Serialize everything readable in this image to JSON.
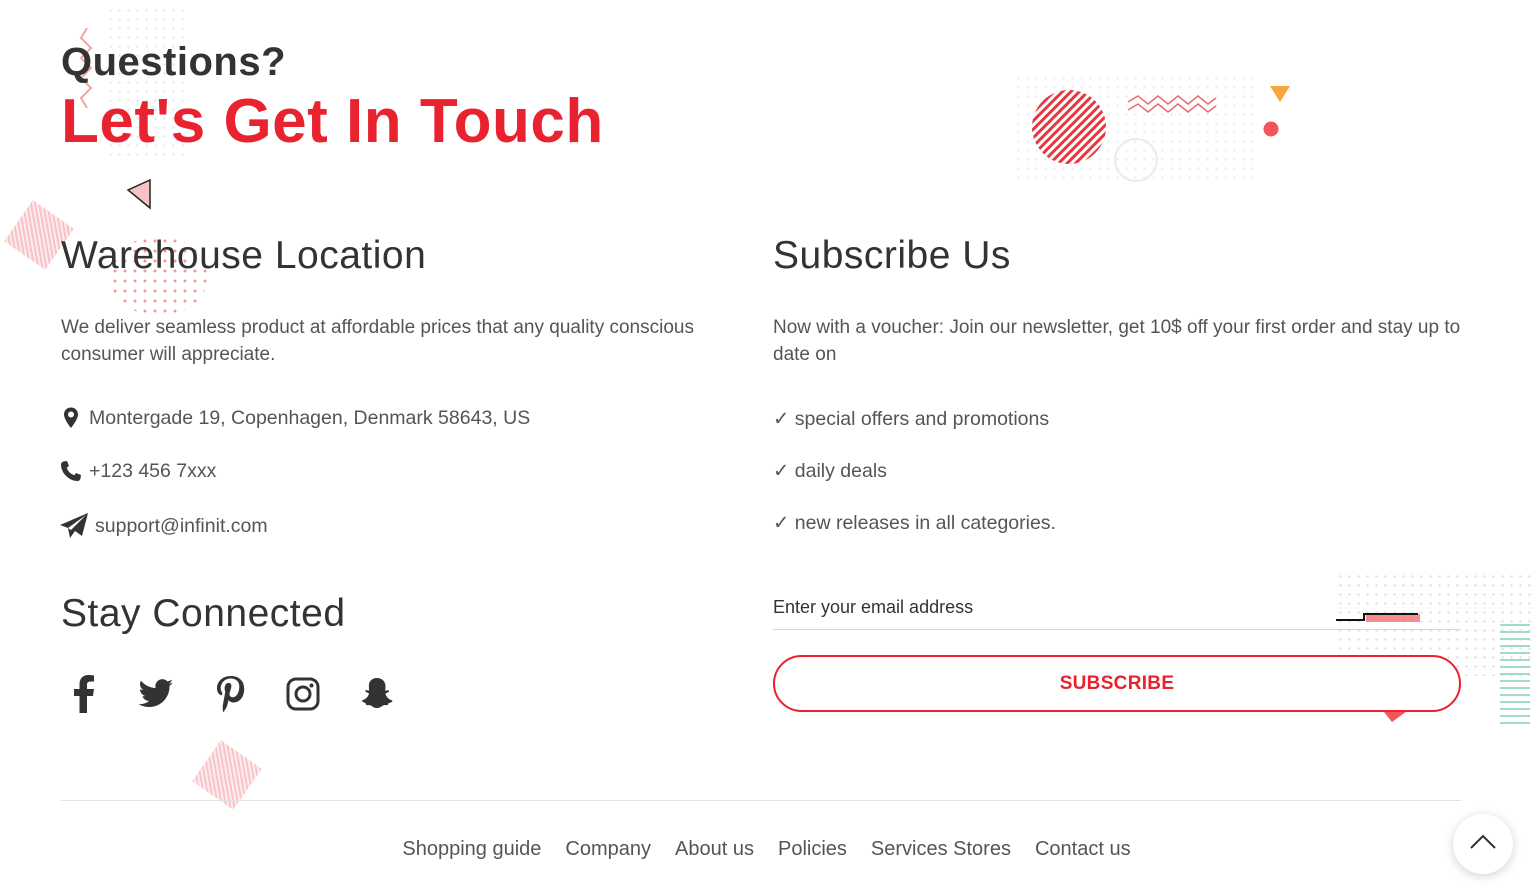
{
  "header": {
    "eyebrow": "Questions?",
    "title": "Let's Get In Touch"
  },
  "warehouse": {
    "heading": "Warehouse Location",
    "description": "We deliver seamless product at affordable prices that any quality conscious consumer will appreciate.",
    "address": "Montergade 19, Copenhagen, Denmark 58643, US",
    "phone": "+123 456 7xxx",
    "email": "support@infinit.com"
  },
  "social": {
    "heading": "Stay Connected",
    "icons": [
      "facebook-icon",
      "twitter-icon",
      "pinterest-icon",
      "instagram-icon",
      "snapchat-icon"
    ]
  },
  "subscribe": {
    "heading": "Subscribe Us",
    "description": "Now with a voucher: Join our newsletter, get 10$ off your first order and stay up to date on",
    "benefits": [
      "✓ special offers and promotions",
      "✓ daily deals",
      "✓ new releases in all categories."
    ],
    "email_placeholder": "Enter your email address",
    "button_label": "SUBSCRIBE"
  },
  "footer": {
    "links": [
      "Shopping guide",
      "Company",
      "About us",
      "Policies",
      "Services Stores",
      "Contact us"
    ]
  },
  "colors": {
    "accent": "#e8232f",
    "heading": "#333333",
    "text": "#555555"
  }
}
